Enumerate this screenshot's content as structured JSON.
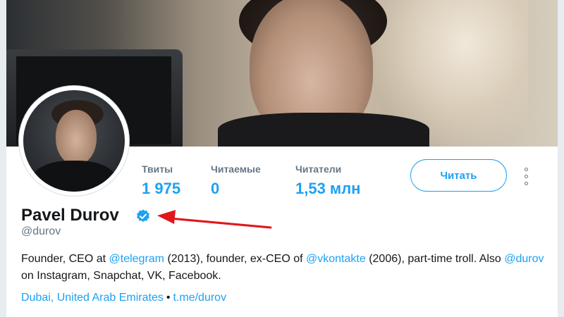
{
  "profile": {
    "name": "Pavel Durov",
    "handle": "@durov",
    "verified": true
  },
  "stats": [
    {
      "label": "Твиты",
      "value": "1 975"
    },
    {
      "label": "Читаемые",
      "value": "0"
    },
    {
      "label": "Читатели",
      "value": "1,53 млн"
    }
  ],
  "actions": {
    "follow_label": "Читать",
    "more_icon": "more-vertical-icon"
  },
  "bio": {
    "t1": "Founder, CEO at ",
    "m1": "@telegram",
    "t2": " (2013), founder, ex-CEO of ",
    "m2": "@vkontakte",
    "t3": " (2006), part-time troll. Also ",
    "m3": "@durov",
    "t4": " on Instagram, Snapchat, VK, Facebook."
  },
  "meta": {
    "location": "Dubai, United Arab Emirates",
    "separator": "•",
    "website": "t.me/durov"
  },
  "colors": {
    "accent": "#1da1f2",
    "secondary_text": "#657786",
    "annotation_arrow": "#e0171b"
  }
}
